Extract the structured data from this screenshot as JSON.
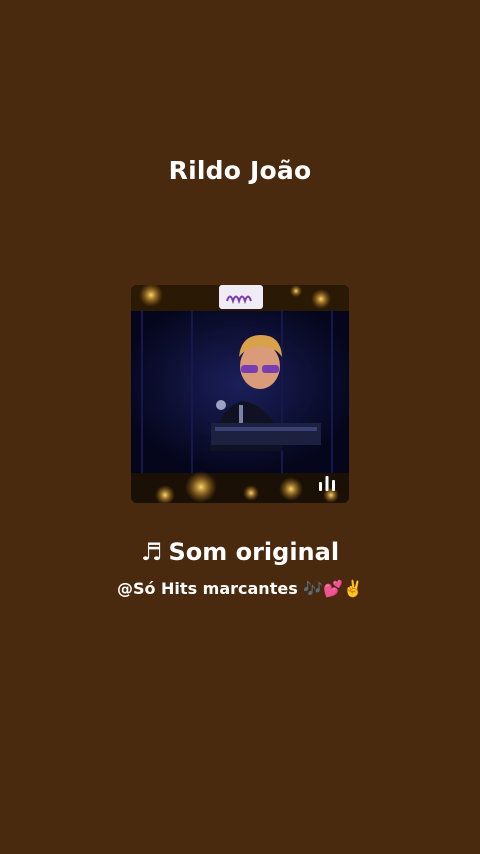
{
  "profile": {
    "author_name": "Rildo João"
  },
  "sound": {
    "note_glyph": "♬",
    "title": "Som original",
    "owner": "@Só Hits marcantes 🎶💕✌️"
  },
  "cover": {
    "equalizer_icon": "equalizer-bars-icon",
    "accent_colors": {
      "background": "#4a2a0e",
      "cover_dark": "#0a0b2c",
      "sparkle": "#f3c24a"
    }
  }
}
